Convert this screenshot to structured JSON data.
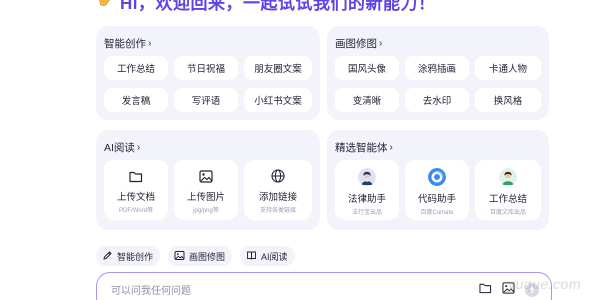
{
  "header": {
    "title": "Hi，欢迎回来，一起试试我们的新能力！"
  },
  "cards": {
    "writing": {
      "title": "智能创作",
      "items": [
        "工作总结",
        "节日祝福",
        "朋友圈文案",
        "发言稿",
        "写评语",
        "小红书文案"
      ]
    },
    "image": {
      "title": "画图修图",
      "items": [
        "国风头像",
        "涂鸦插画",
        "卡通人物",
        "变清晰",
        "去水印",
        "换风格"
      ]
    },
    "reading": {
      "title": "AI阅读",
      "tiles": [
        {
          "label": "上传文档",
          "sub": "PDF/Word等",
          "icon": "folder-icon"
        },
        {
          "label": "上传图片",
          "sub": "jpg/png等",
          "icon": "image-icon"
        },
        {
          "label": "添加链接",
          "sub": "支持各类链接",
          "icon": "globe-icon"
        }
      ]
    },
    "agents": {
      "title": "精选智能体",
      "tiles": [
        {
          "label": "法律助手",
          "sub": "法行宝出品",
          "icon": "lawyer-avatar-icon"
        },
        {
          "label": "代码助手",
          "sub": "百度Comate",
          "icon": "code-assistant-logo-icon"
        },
        {
          "label": "工作总结",
          "sub": "百度文库出品",
          "icon": "worker-avatar-icon"
        }
      ]
    }
  },
  "chips": [
    {
      "label": "智能创作",
      "icon": "pen-icon"
    },
    {
      "label": "画图修图",
      "icon": "picture-icon"
    },
    {
      "label": "AI阅读",
      "icon": "book-icon"
    }
  ],
  "input": {
    "placeholder": "可以问我任何问题"
  },
  "watermark": "yuque.com",
  "colors": {
    "accent": "#5d43e8",
    "card_bg": "#f3f4fb",
    "input_border": "#a694f5"
  }
}
